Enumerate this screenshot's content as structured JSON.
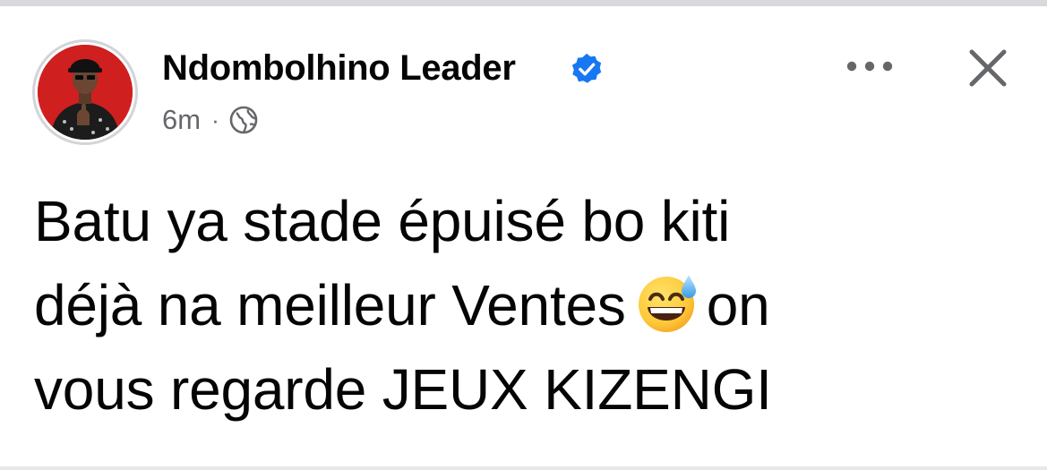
{
  "post": {
    "author": {
      "name": "Ndombolhino Leader",
      "verified": true,
      "avatar_icon": "profile-photo",
      "avatar_bg_color": "#d01f1f"
    },
    "time": "6m",
    "separator": "·",
    "visibility_icon": "globe-icon",
    "more_icon": "more-options-icon",
    "close_icon": "close-icon",
    "text": {
      "line1": "Batu ya stade épuisé bo kiti",
      "line2_before_emoji": "déjà na meilleur Ventes",
      "emoji_icon": "grinning-face-with-sweat-emoji",
      "line2_after_emoji": "on",
      "line3": "vous regarde JEUX KIZENGI"
    }
  },
  "colors": {
    "primary_text": "#050505",
    "secondary_text": "#65676b",
    "verified_blue": "#1877f2",
    "top_strip": "#d7d9dd"
  }
}
